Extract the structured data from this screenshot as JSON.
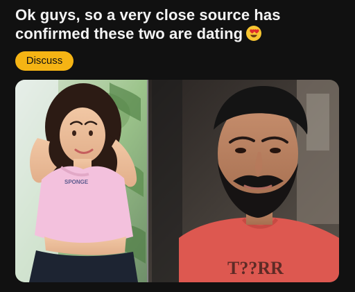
{
  "post": {
    "title": "Ok guys, so a very close source has confirmed these two are dating",
    "emoji_icon": "heart-eyes-emoji-icon",
    "tag_label": "Discuss",
    "tag_color": "#f5b414",
    "background": "#111111"
  },
  "media": {
    "left_photo_shirt_text": "SPONGE",
    "right_photo_shirt_text": "T??RR",
    "icons": [
      "left-photo-image",
      "right-photo-image"
    ]
  }
}
